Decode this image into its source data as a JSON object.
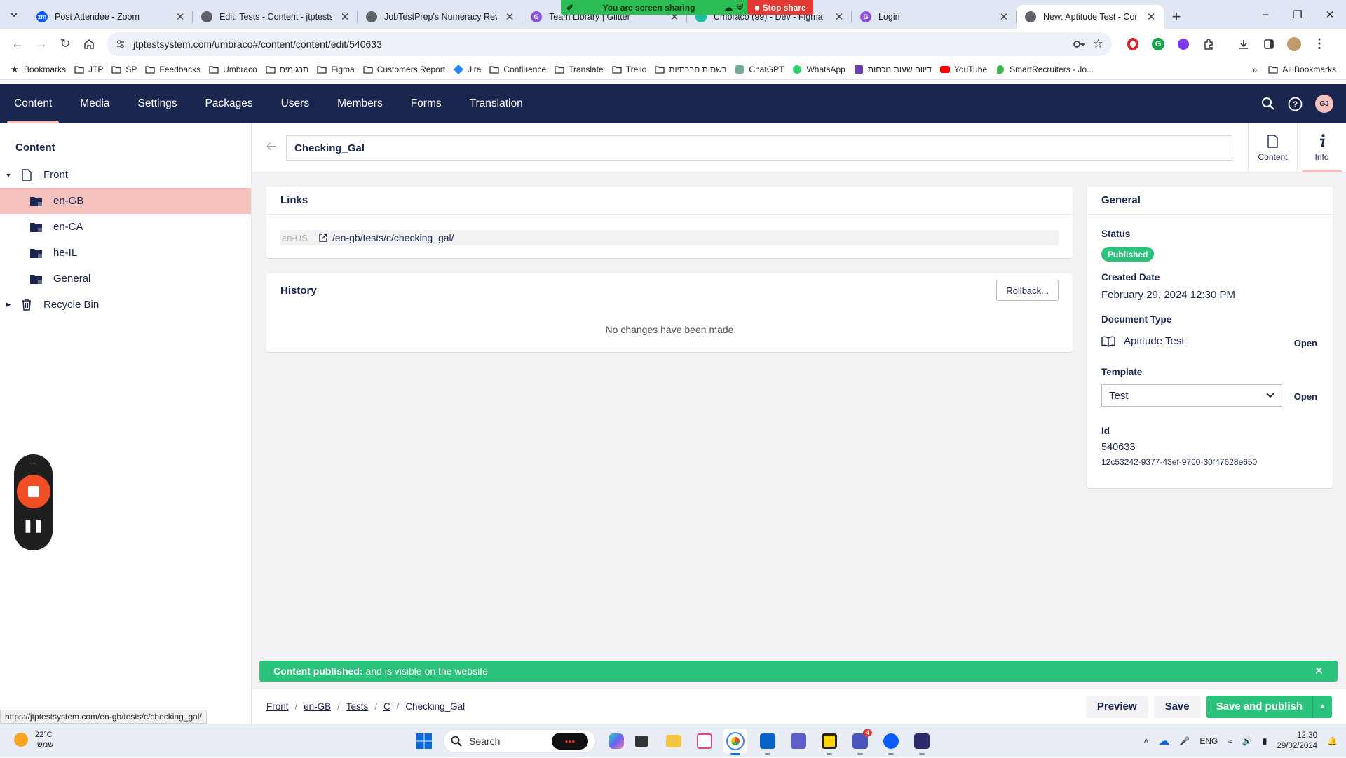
{
  "browser": {
    "tabs": [
      {
        "title": "Post Attendee - Zoom",
        "favicon": "zoom-icon",
        "color": "#0b5cff",
        "glyph": "zm"
      },
      {
        "title": "Edit: Tests - Content - jtptestsy",
        "favicon": "globe-icon",
        "color": "#5f6368",
        "glyph": ""
      },
      {
        "title": "JobTestPrep's Numeracy Review",
        "favicon": "globe-icon",
        "color": "#5f6368",
        "glyph": ""
      },
      {
        "title": "Team Library | Glitter",
        "favicon": "g-icon",
        "color": "#8f56d9",
        "glyph": "G"
      },
      {
        "title": "Umbraco (99) - Dev - Figma",
        "favicon": "figma-icon",
        "color": "#1abc9c",
        "glyph": ""
      },
      {
        "title": "Login",
        "favicon": "g-icon",
        "color": "#8f56d9",
        "glyph": "G"
      },
      {
        "title": "New: Aptitude Test - Content -",
        "favicon": "globe-icon",
        "color": "#5f6368",
        "glyph": ""
      }
    ],
    "share_banner": "You are screen sharing",
    "stop_share": "Stop share",
    "url": "jtptestsystem.com/umbraco#/content/content/edit/540633",
    "bookmarks": [
      {
        "label": "Bookmarks",
        "icon": "star-icon"
      },
      {
        "label": "JTP",
        "icon": "folder-icon"
      },
      {
        "label": "SP",
        "icon": "folder-icon"
      },
      {
        "label": "Feedbacks",
        "icon": "folder-icon"
      },
      {
        "label": "Umbraco",
        "icon": "folder-icon"
      },
      {
        "label": "תרגומים",
        "icon": "folder-icon"
      },
      {
        "label": "Figma",
        "icon": "folder-icon"
      },
      {
        "label": "Customers Report",
        "icon": "folder-icon"
      },
      {
        "label": "Jira",
        "icon": "jira-icon"
      },
      {
        "label": "Confluence",
        "icon": "folder-icon"
      },
      {
        "label": "Translate",
        "icon": "folder-icon"
      },
      {
        "label": "Trello",
        "icon": "folder-icon"
      },
      {
        "label": "רשתות חברתיות",
        "icon": "folder-icon"
      },
      {
        "label": "ChatGPT",
        "icon": "chatgpt-icon"
      },
      {
        "label": "WhatsApp",
        "icon": "whatsapp-icon"
      },
      {
        "label": "דיווח שעות נוכחות",
        "icon": "calendar-icon"
      },
      {
        "label": "YouTube",
        "icon": "youtube-icon"
      },
      {
        "label": "SmartRecruiters - Jo...",
        "icon": "smartrecruiters-icon"
      }
    ],
    "bookmarks_more": "»",
    "all_bookmarks": "All Bookmarks",
    "status_url": "https://jtptestsystem.com/en-gb/tests/c/checking_gal/"
  },
  "header": {
    "sections": [
      "Content",
      "Media",
      "Settings",
      "Packages",
      "Users",
      "Members",
      "Forms",
      "Translation"
    ],
    "active_section": "Content",
    "user_initials": "GJ"
  },
  "tree": {
    "title": "Content",
    "items": [
      {
        "label": "Front",
        "icon": "document-icon",
        "level": 0,
        "expanded": true
      },
      {
        "label": "en-GB",
        "icon": "folder-icon",
        "level": 1,
        "selected": true
      },
      {
        "label": "en-CA",
        "icon": "folder-icon",
        "level": 1
      },
      {
        "label": "he-IL",
        "icon": "folder-icon",
        "level": 1
      },
      {
        "label": "General",
        "icon": "folder-icon",
        "level": 1
      },
      {
        "label": "Recycle Bin",
        "icon": "trash-icon",
        "level": 0,
        "expanded": false
      }
    ]
  },
  "editor": {
    "name": "Checking_Gal",
    "apps": [
      {
        "label": "Content",
        "icon": "document-icon"
      },
      {
        "label": "Info",
        "icon": "info-icon",
        "active": true
      }
    ],
    "links": {
      "title": "Links",
      "culture": "en-US",
      "url": "/en-gb/tests/c/checking_gal/"
    },
    "history": {
      "title": "History",
      "rollback": "Rollback...",
      "empty": "No changes have been made"
    },
    "general": {
      "title": "General",
      "status_label": "Status",
      "status": "Published",
      "created_label": "Created Date",
      "created": "February 29, 2024 12:30 PM",
      "doctype_label": "Document Type",
      "doctype": "Aptitude Test",
      "open": "Open",
      "template_label": "Template",
      "template": "Test",
      "id_label": "Id",
      "id": "540633",
      "guid": "12c53242-9377-43ef-9700-30f47628e650"
    }
  },
  "notification": {
    "strong": "Content published:",
    "text": "and is visible on the website"
  },
  "footer": {
    "breadcrumb": [
      "Front",
      "en-GB",
      "Tests",
      "C",
      "Checking_Gal"
    ],
    "preview": "Preview",
    "save": "Save",
    "save_publish": "Save and publish"
  },
  "taskbar": {
    "temperature": "22°C",
    "weather_text": "שמשי",
    "search_placeholder": "Search",
    "language": "ENG",
    "time": "12:30",
    "date": "29/02/2024",
    "badge": "4"
  },
  "colors": {
    "header": "#1b264f",
    "accent": "#f5c1bc",
    "success": "#2bc37c"
  }
}
